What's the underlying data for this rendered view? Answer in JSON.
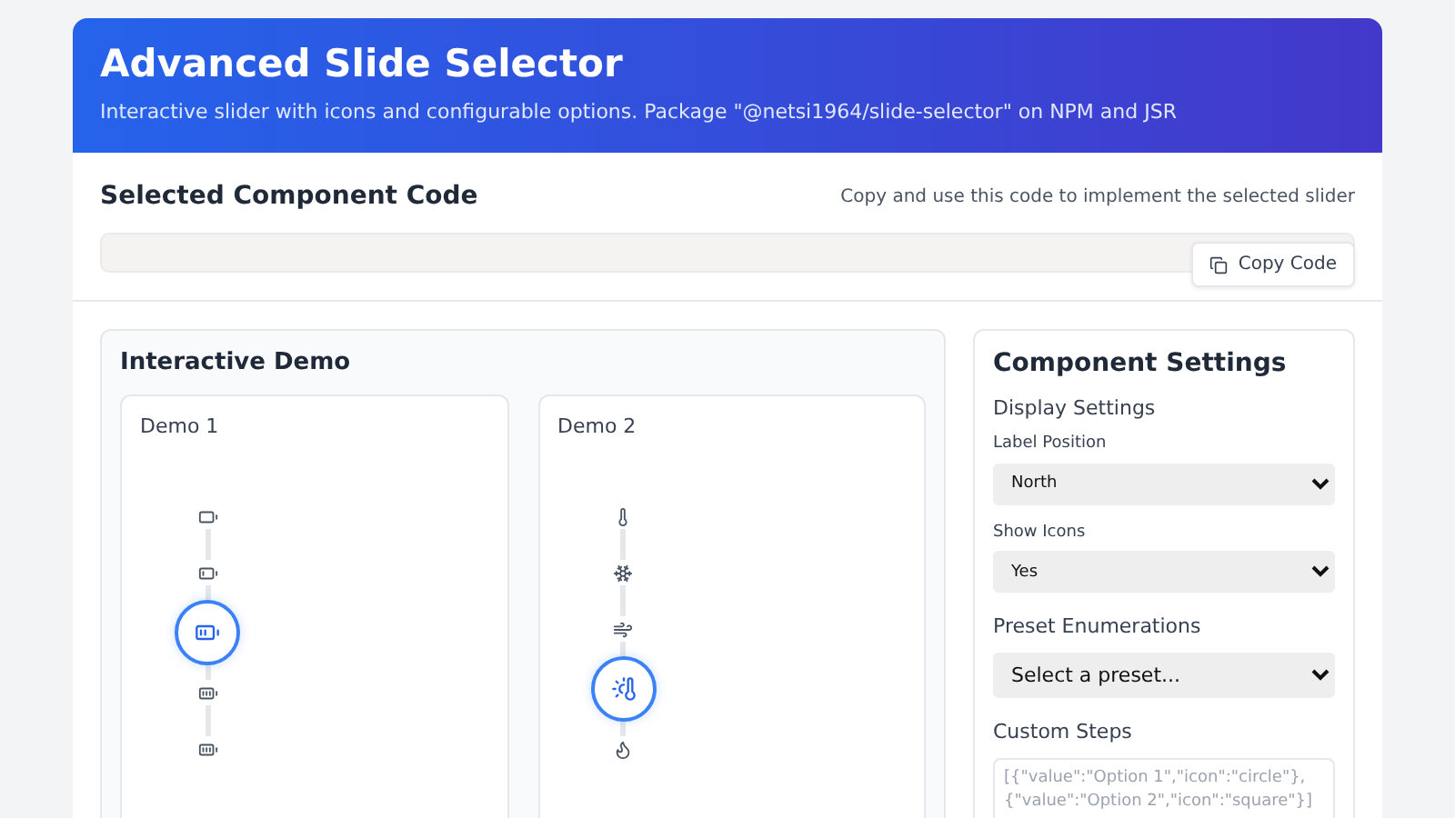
{
  "header": {
    "title": "Advanced Slide Selector",
    "subtitle": "Interactive slider with icons and configurable options. Package \"@netsi1964/slide-selector\" on NPM and JSR"
  },
  "code_section": {
    "title": "Selected Component Code",
    "hint": "Copy and use this code to implement the selected slider",
    "copy_button": "Copy Code"
  },
  "demo_panel": {
    "title": "Interactive Demo",
    "demos": [
      {
        "title": "Demo 1",
        "steps": [
          {
            "selected": false
          },
          {
            "selected": false
          },
          {
            "selected": true
          },
          {
            "selected": false
          },
          {
            "selected": false
          }
        ]
      },
      {
        "title": "Demo 2",
        "steps": [
          {
            "selected": false
          },
          {
            "selected": false
          },
          {
            "selected": false
          },
          {
            "selected": true
          },
          {
            "selected": false
          }
        ]
      }
    ]
  },
  "settings": {
    "title": "Component Settings",
    "display_heading": "Display Settings",
    "fields": [
      {
        "label": "Label Position",
        "value": "North"
      },
      {
        "label": "Show Icons",
        "value": "Yes"
      }
    ],
    "preset_heading": "Preset Enumerations",
    "preset_value": "Select a preset...",
    "custom_heading": "Custom Steps",
    "custom_placeholder": "[{\"value\":\"Option 1\",\"icon\":\"circle\"},{\"value\":\"Option 2\",\"icon\":\"square\"}]"
  }
}
